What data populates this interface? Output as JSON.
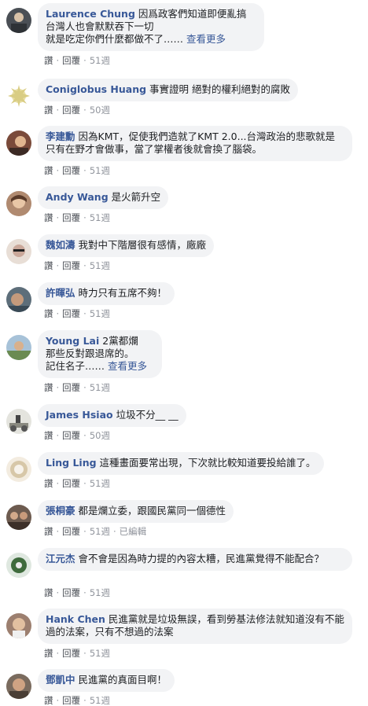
{
  "comments": [
    {
      "name": "Laurence Chung",
      "text": "因爲政客們知道即便亂搞\n台灣人也會默默吞下一切\n就是吃定你們什麼都做不了……",
      "more": "查看更多",
      "like": "讚",
      "reply": "回覆",
      "time": "51週",
      "edited": "",
      "avatar_color": "#4a4f55"
    },
    {
      "name": "Coniglobus Huang",
      "text": "事實證明 絕對的權利絕對的腐敗",
      "more": "",
      "like": "讚",
      "reply": "回覆",
      "time": "50週",
      "edited": "",
      "avatar_color": "#e9dfa4"
    },
    {
      "name": "李建勳",
      "text": "因為KMT，促使我們造就了KMT 2.0...台灣政治的悲歌就是只有在野才會做事，當了掌權者後就會換了腦袋。",
      "more": "",
      "like": "讚",
      "reply": "回覆",
      "time": "51週",
      "edited": "",
      "avatar_color": "#7a4a3a"
    },
    {
      "name": "Andy Wang",
      "text": "是火箭升空",
      "more": "",
      "like": "讚",
      "reply": "回覆",
      "time": "51週",
      "edited": "",
      "avatar_color": "#b08a70"
    },
    {
      "name": "魏如濤",
      "text": "我對中下階層很有感情，廠廠",
      "more": "",
      "like": "讚",
      "reply": "回覆",
      "time": "51週",
      "edited": "",
      "avatar_color": "#caa89a"
    },
    {
      "name": "許暉弘",
      "text": "時力只有五席不夠！",
      "more": "",
      "like": "讚",
      "reply": "回覆",
      "time": "51週",
      "edited": "",
      "avatar_color": "#5d6e7a"
    },
    {
      "name": "Young Lai",
      "text": "2黨都爛\n那些反對跟退席的。\n記住名子……",
      "more": "查看更多",
      "like": "讚",
      "reply": "回覆",
      "time": "51週",
      "edited": "",
      "avatar_color": "#6a8b52"
    },
    {
      "name": "James Hsiao",
      "text": "垃圾不分__ __",
      "more": "",
      "like": "讚",
      "reply": "回覆",
      "time": "50週",
      "edited": "",
      "avatar_color": "#c9c9c2"
    },
    {
      "name": "Ling Ling",
      "text": "這種畫面要常出現，下次就比較知道要投給誰了。",
      "more": "",
      "like": "讚",
      "reply": "回覆",
      "time": "51週",
      "edited": "",
      "avatar_color": "#d7c7a8"
    },
    {
      "name": "張桐豪",
      "text": "都是爛立委，跟國民黨同一個德性",
      "more": "",
      "like": "讚",
      "reply": "回覆",
      "time": "51週",
      "edited": "已編輯",
      "avatar_color": "#6d5b4f"
    },
    {
      "name": "江元杰",
      "text": "會不會是因為時力提的內容太糟，民進黨覺得不能配合？",
      "more": "",
      "like": "讚",
      "reply": "回覆",
      "time": "51週",
      "edited": "",
      "avatar_color": "#3f6b3d"
    },
    {
      "name": "Hank Chen",
      "text": "民進黨就是垃圾無誤，看到勞基法修法就知道沒有不能過的法案，只有不想過的法案",
      "more": "",
      "like": "讚",
      "reply": "回覆",
      "time": "51週",
      "edited": "",
      "avatar_color": "#9c7f6f"
    },
    {
      "name": "鄧凱中",
      "text": "民進黨的真面目啊！",
      "more": "",
      "like": "讚",
      "reply": "回覆",
      "time": "51週",
      "edited": "",
      "avatar_color": "#7a6b5e"
    }
  ]
}
